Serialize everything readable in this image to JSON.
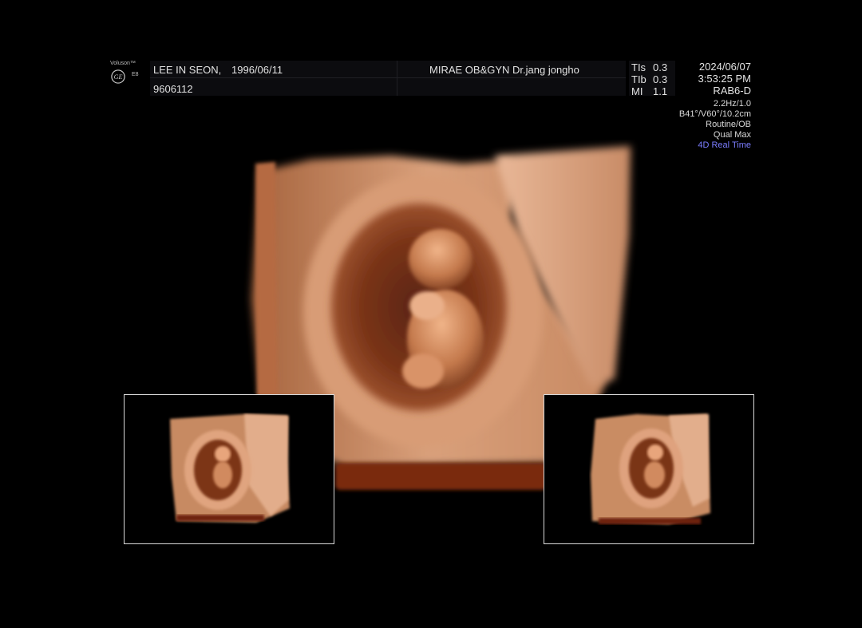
{
  "device": {
    "brand_label": "Voluson™",
    "model_label": "E8",
    "logo_icon": "ge-logo-icon"
  },
  "patient": {
    "name": "LEE IN SEON,",
    "dob": "1996/06/11",
    "id": "9606112"
  },
  "clinic": {
    "label": "MIRAE OB&GYN Dr.jang jongho"
  },
  "indices": [
    {
      "name": "TIs",
      "value": "0.3"
    },
    {
      "name": "TIb",
      "value": "0.3"
    },
    {
      "name": "MI",
      "value": "1.1"
    }
  ],
  "exam": {
    "date": "2024/06/07",
    "time": "3:53:25 PM",
    "probe": "RAB6-D"
  },
  "parameters": {
    "frame_rate": "2.2Hz/1.0",
    "volume": "B41°/V60°/10.2cm",
    "preset": "Routine/OB",
    "quality": "Qual Max",
    "mode": "4D Real Time"
  },
  "colors": {
    "background": "#000000",
    "mode_accent": "#7b7dff",
    "render_tone": "#c98d66",
    "thumb_border": "#d9d9d9"
  }
}
